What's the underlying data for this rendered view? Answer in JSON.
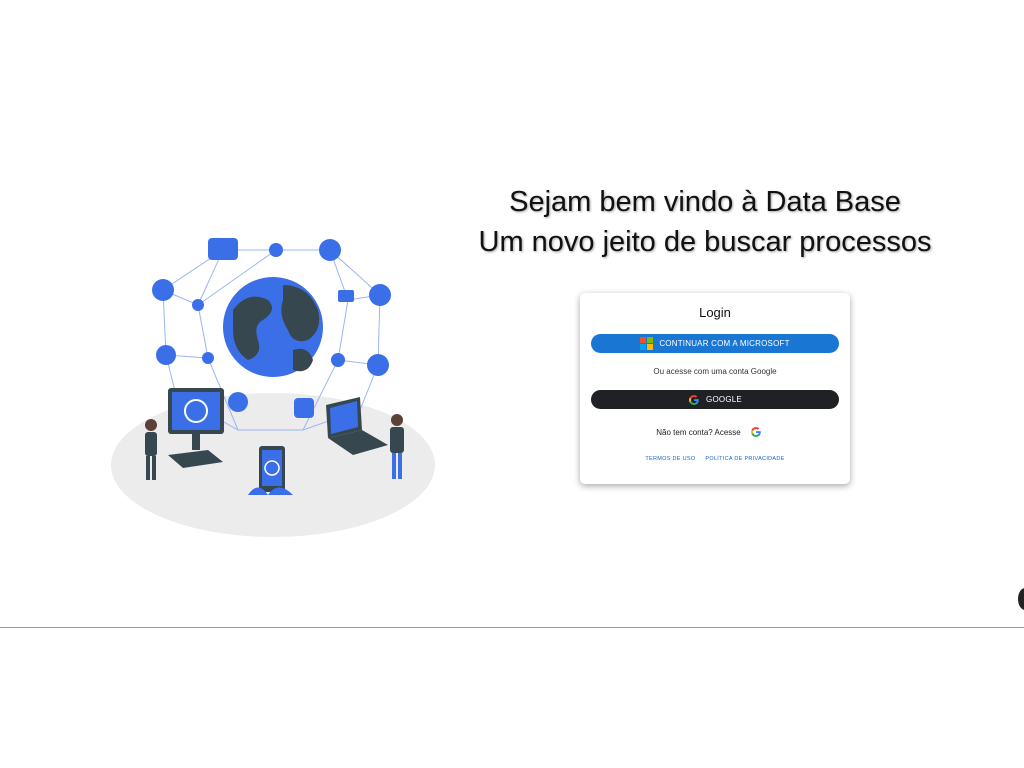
{
  "headline": {
    "line1": "Sejam bem vindo à Data Base",
    "line2": "Um novo jeito de buscar processos"
  },
  "login": {
    "title": "Login",
    "microsoft_button": "CONTINUAR COM A MICROSOFT",
    "alt_text": "Ou acesse com uma conta Google",
    "google_button": "GOOGLE",
    "signup_text": "Não tem conta? Acesse",
    "terms_link": "TERMOS DE USO",
    "privacy_link": "POLÍTICA DE PRIVACIDADE"
  },
  "icons": {
    "microsoft": "microsoft-icon",
    "google": "google-icon"
  },
  "colors": {
    "primary": "#1976d2",
    "dark_button": "#202124",
    "illustration_blue": "#3b6fe8",
    "globe_dark": "#37474f",
    "link": "#1565c0"
  }
}
